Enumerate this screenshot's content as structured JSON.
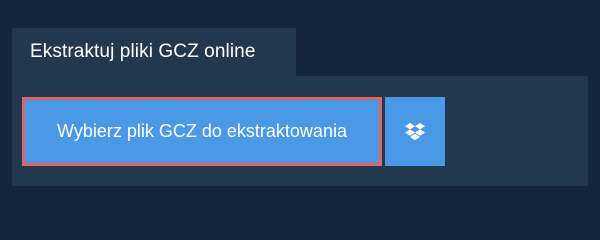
{
  "tab": {
    "title": "Ekstraktuj pliki GCZ online"
  },
  "upload": {
    "choose_label": "Wybierz plik GCZ do ekstraktowania",
    "dropbox_icon": "dropbox-icon"
  },
  "colors": {
    "background": "#13263d",
    "panel": "#22384f",
    "button": "#4a99e6",
    "focus_border": "#e06666"
  }
}
